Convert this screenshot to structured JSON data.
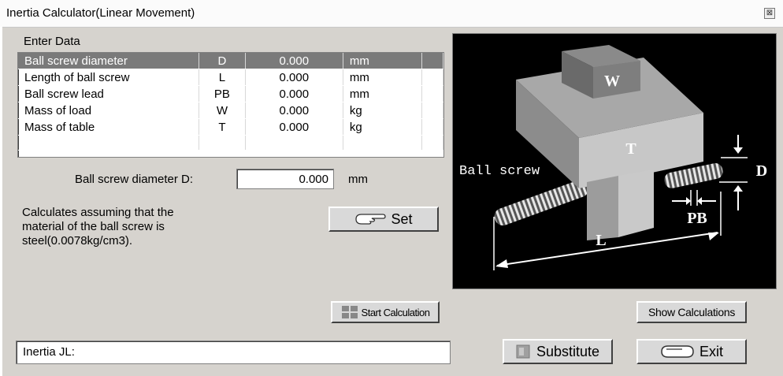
{
  "window": {
    "title": "Inertia Calculator(Linear Movement)",
    "close_glyph": "⊠"
  },
  "enter_data": {
    "label": "Enter Data",
    "rows": [
      {
        "name": "Ball screw diameter",
        "symbol": "D",
        "value": "0.000",
        "unit": "mm",
        "selected": true
      },
      {
        "name": "Length of ball screw",
        "symbol": "L",
        "value": "0.000",
        "unit": "mm"
      },
      {
        "name": "Ball screw lead",
        "symbol": "PB",
        "value": "0.000",
        "unit": "mm"
      },
      {
        "name": "Mass of load",
        "symbol": "W",
        "value": "0.000",
        "unit": "kg"
      },
      {
        "name": "Mass of table",
        "symbol": "T",
        "value": "0.000",
        "unit": "kg"
      }
    ]
  },
  "field": {
    "label": "Ball screw diameter  D:",
    "value": "0.000",
    "unit": "mm"
  },
  "note": [
    "Calculates assuming that the",
    "material of the ball screw is",
    "steel(0.0078kg/cm3)."
  ],
  "buttons": {
    "set": "Set",
    "start_calculation": "Start Calculation",
    "show_calculations": "Show Calculations",
    "substitute": "Substitute",
    "exit": "Exit"
  },
  "status": {
    "label": "Inertia JL:"
  },
  "diagram": {
    "labels": {
      "w": "W",
      "t": "T",
      "ball_screw": "Ball screw",
      "d": "D",
      "pb": "PB",
      "l": "L"
    }
  },
  "colors": {
    "selected_row": "#7a7a7a",
    "window_bg": "#d6d3ce",
    "diagram_bg": "#000000"
  }
}
